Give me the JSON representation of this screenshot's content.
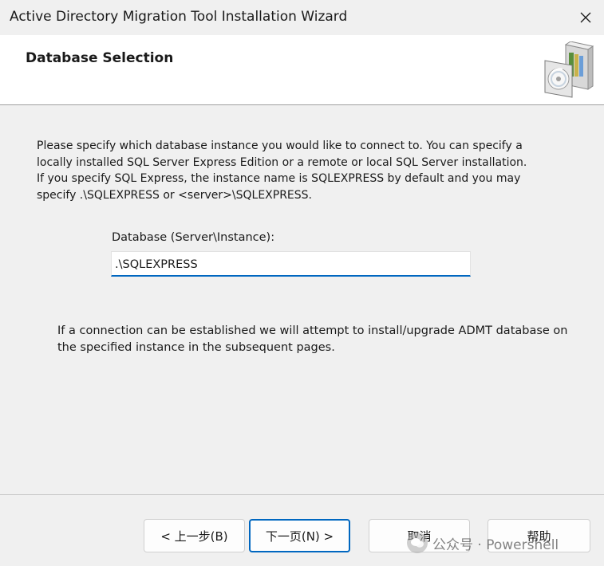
{
  "window": {
    "title": "Active Directory Migration Tool Installation Wizard",
    "close_icon": "close-icon"
  },
  "header": {
    "title": "Database Selection",
    "icon": "installer-box-icon"
  },
  "description": {
    "lines": [
      "Please specify which database instance you would like to connect to. You can specify a",
      "locally installed SQL Server Express Edition or a remote or local SQL Server installation.",
      "If you specify SQL Express, the instance name is SQLEXPRESS by default and you may",
      "specify .\\SQLEXPRESS or <server>\\SQLEXPRESS."
    ]
  },
  "database_field": {
    "label": "Database (Server\\Instance):",
    "value": ".\\SQLEXPRESS"
  },
  "note": {
    "lines": [
      "If a connection can be established we will attempt to install/upgrade ADMT database on",
      "the specified instance in the subsequent pages."
    ]
  },
  "buttons": {
    "back": "< 上一步(B)",
    "next": "下一页(N) >",
    "cancel": "取消",
    "help": "帮助"
  },
  "watermark": {
    "text": "公众号 · Powershell"
  },
  "colors": {
    "accent": "#0067c0",
    "background": "#f0f0f0",
    "header_background": "#ffffff"
  }
}
